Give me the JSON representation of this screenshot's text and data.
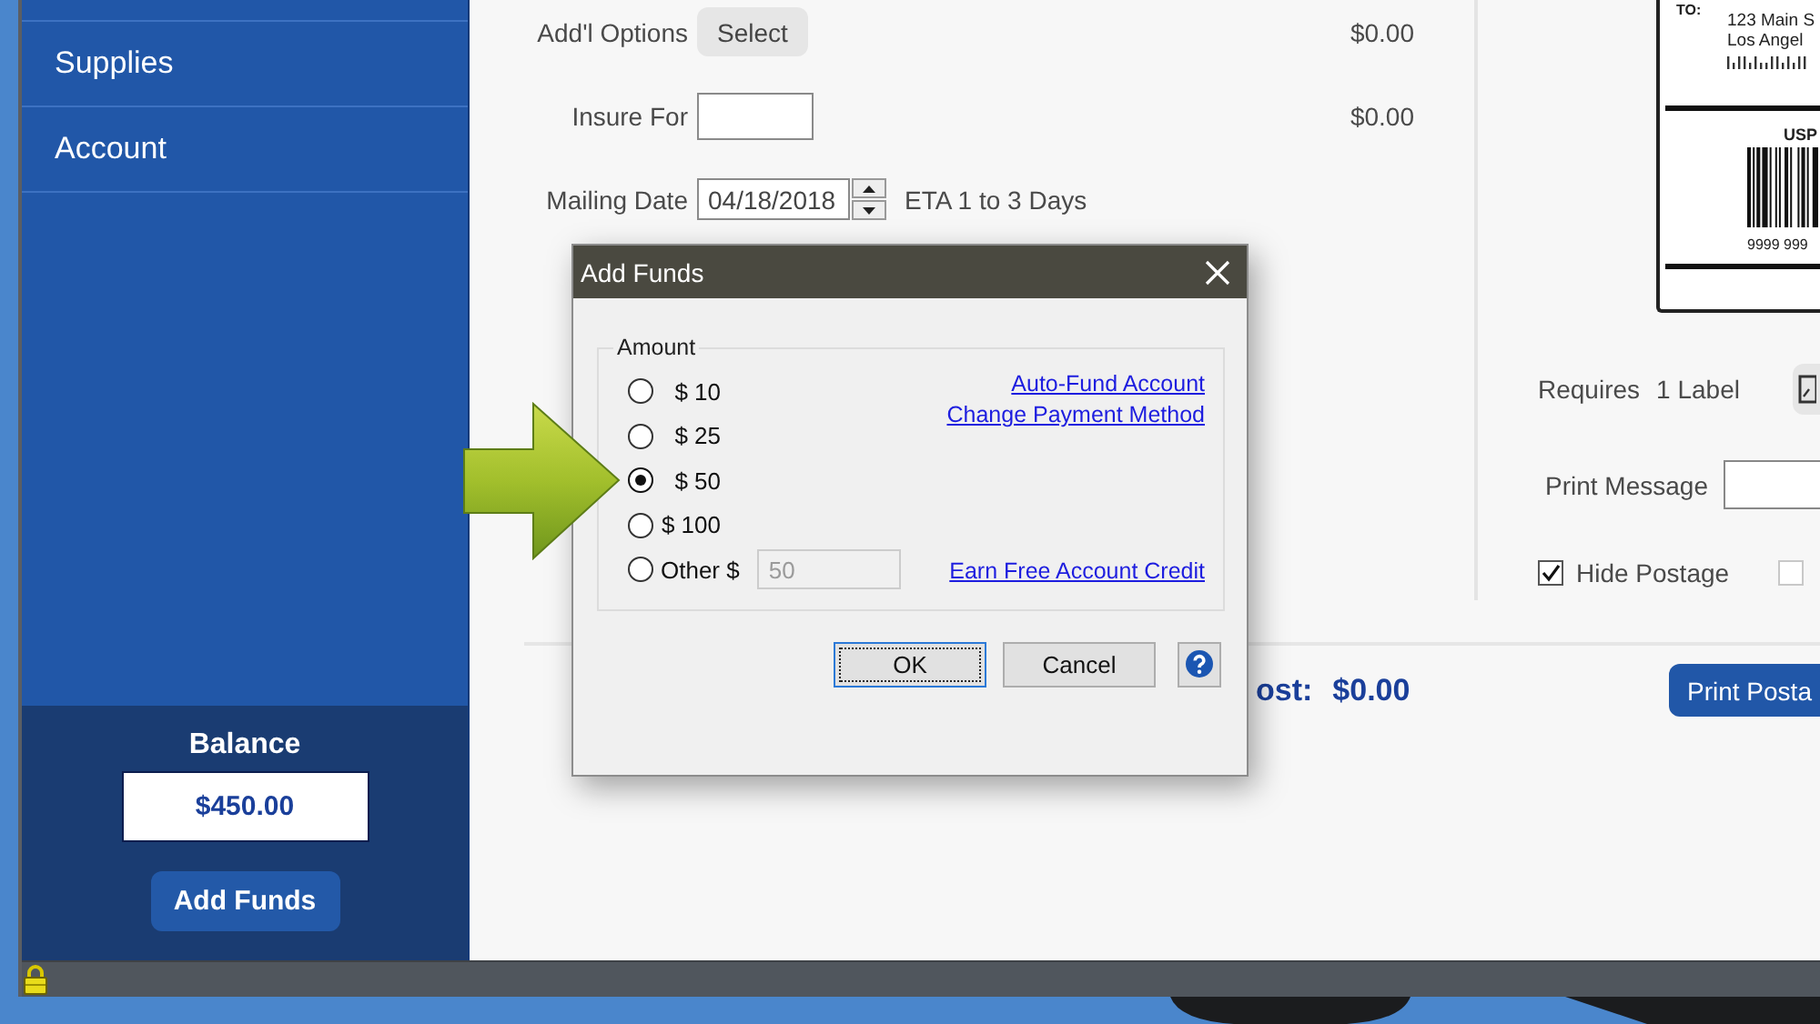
{
  "sidebar": {
    "items": [
      {
        "label": "Supplies",
        "selected": false
      },
      {
        "label": "Account",
        "selected": false
      }
    ],
    "balance": {
      "label": "Balance",
      "value": "$450.00"
    },
    "button": "Add Funds"
  },
  "form": {
    "rows": [
      {
        "kind": "select",
        "label": "Add'l Options",
        "button": "Select",
        "amount": "$0.00"
      },
      {
        "kind": "input",
        "label": "Insure For",
        "amount": "$0.00"
      },
      {
        "kind": "date",
        "label": "Mailing Date",
        "value": "04/18/2018",
        "note": "ETA 1 to 3 Days"
      }
    ]
  },
  "label_preview": {
    "to": "TO:",
    "address": [
      "123 Main S",
      "Los Angel"
    ],
    "carrier": "USP",
    "tracking": "9999 999"
  },
  "options": {
    "requires": {
      "label": "Requires",
      "value": "1 Label"
    },
    "print_message": {
      "label": "Print Message"
    },
    "checkboxes": [
      {
        "label": "Hide Postage",
        "checked": true
      },
      {
        "checked": false
      }
    ]
  },
  "footer": {
    "total": {
      "label": "ost:",
      "value": "$0.00"
    },
    "print_button": "Print Posta"
  },
  "dialog": {
    "title": "Add Funds",
    "group": "Amount",
    "amounts": [
      {
        "kind": "preset",
        "label": "$ 10",
        "selected": false
      },
      {
        "kind": "preset",
        "label": "$ 25",
        "selected": false
      },
      {
        "kind": "preset",
        "label": "$ 50",
        "selected": true
      },
      {
        "kind": "preset",
        "label": "$ 100",
        "selected": false
      },
      {
        "kind": "other",
        "label": "Other $",
        "selected": false,
        "field": {
          "value": "50",
          "disabled": true
        }
      }
    ],
    "links": [
      "Auto-Fund Account",
      "Change Payment Method",
      "Earn Free Account Credit"
    ],
    "buttons": [
      {
        "label": "OK",
        "default": true
      },
      {
        "label": "Cancel",
        "default": false
      }
    ]
  }
}
